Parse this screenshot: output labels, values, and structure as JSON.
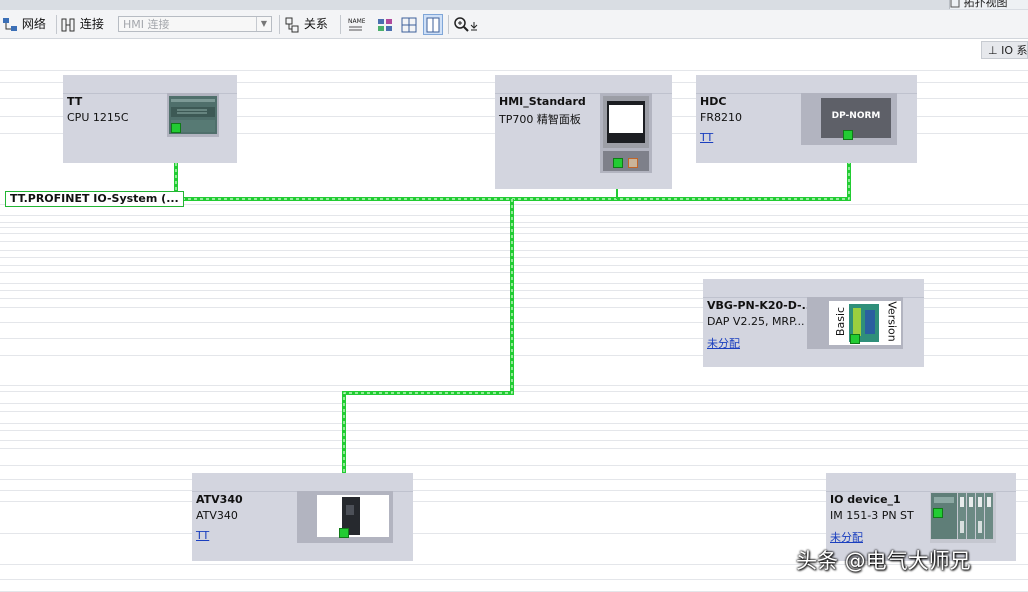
{
  "window": {
    "tab_label": "拓扑视图"
  },
  "toolbar": {
    "network_label": "网络",
    "connections_label": "连接",
    "hmi_connection_placeholder": "HMI 连接",
    "relations_label": "关系",
    "zoom_icon": "zoom-icon"
  },
  "side_button": {
    "label": "IO 系"
  },
  "network": {
    "label": "TT.PROFINET IO-System (..."
  },
  "devices": {
    "tt": {
      "name": "TT",
      "type": "CPU 1215C"
    },
    "hmi": {
      "name": "HMI_Standard",
      "type": "TP700 精智面板"
    },
    "hdc": {
      "name": "HDC",
      "type": "FR8210",
      "link": "TT",
      "image_label": "DP-NORM"
    },
    "vbg": {
      "name": "VBG-PN-K20-D-...",
      "type": "DAP V2.25, MRP...",
      "link": "未分配",
      "image_label_1": "Basic",
      "image_label_2": "Version"
    },
    "atv": {
      "name": "ATV340",
      "type": "ATV340",
      "link": "TT"
    },
    "iodev": {
      "name": "IO device_1",
      "type": "IM 151-3 PN ST",
      "link": "未分配"
    }
  },
  "colors": {
    "network_line": "#22cc33",
    "device_bg": "#d3d5df",
    "link": "#1a3fbf"
  },
  "watermark": "头条 @电气大师兄"
}
